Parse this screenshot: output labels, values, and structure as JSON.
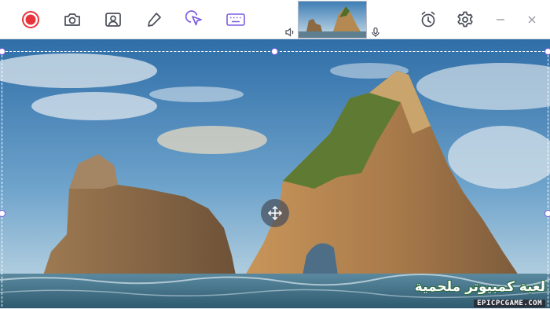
{
  "toolbar": {
    "buttons": [
      {
        "name": "record",
        "icon": "record-icon"
      },
      {
        "name": "screenshot",
        "icon": "camera-icon"
      },
      {
        "name": "webcam",
        "icon": "webcam-icon"
      },
      {
        "name": "annotate",
        "icon": "pencil-icon"
      },
      {
        "name": "cursor-effects",
        "icon": "cursor-click-icon"
      },
      {
        "name": "keystrokes",
        "icon": "keyboard-icon"
      },
      {
        "name": "schedule",
        "icon": "alarm-clock-icon"
      },
      {
        "name": "settings",
        "icon": "gear-icon"
      },
      {
        "name": "minimize",
        "icon": "minimize-icon"
      },
      {
        "name": "close",
        "icon": "close-icon"
      }
    ],
    "preview": {
      "speaker_icon": "speaker-icon",
      "mic_icon": "microphone-icon"
    }
  },
  "capture": {
    "move_handle_icon": "move-arrows-icon"
  },
  "watermark": {
    "arabic_text": "لعبة كمبيوتر ملحمية",
    "site_text": "EPICPCGAME.COM"
  },
  "colors": {
    "record": "#e8323c",
    "icon": "#4a4d57",
    "accent": "#7c5ce0",
    "toolbar_bg": "#ffffff"
  }
}
